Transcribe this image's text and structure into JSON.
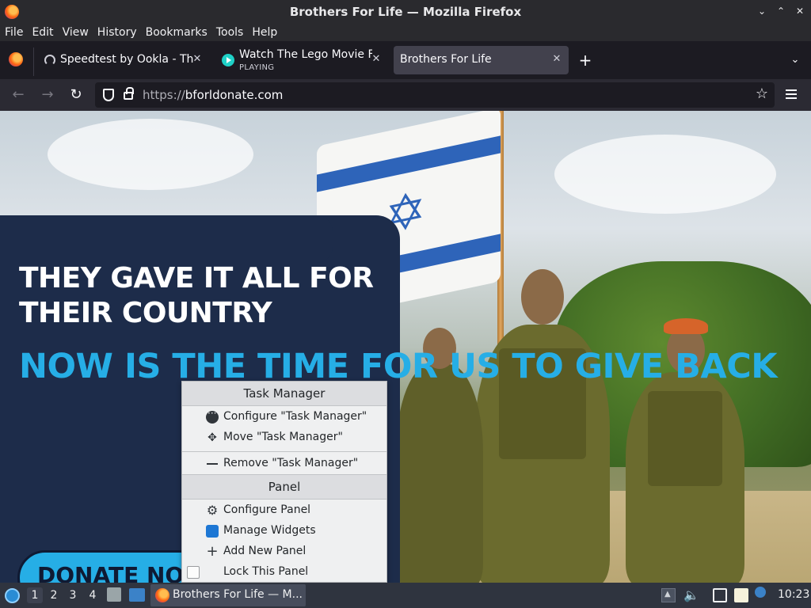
{
  "window": {
    "title": "Brothers For Life — Mozilla Firefox",
    "controls": [
      "⌄",
      "⌃",
      "✕"
    ]
  },
  "menubar": {
    "items": [
      "File",
      "Edit",
      "View",
      "History",
      "Bookmarks",
      "Tools",
      "Help"
    ]
  },
  "tabs": [
    {
      "title": "Speedtest by Ookla - The Global Broadband Speed Test",
      "icon": "speedtest-icon"
    },
    {
      "title": "Watch The Lego Movie Full Movie",
      "subtitle": "PLAYING",
      "icon": "play-icon"
    },
    {
      "title": "Brothers For Life",
      "active": true
    }
  ],
  "navbar": {
    "url_scheme": "https://",
    "url_host": "bforldonate.com"
  },
  "page": {
    "headline_1": "THEY GAVE IT ALL FOR THEIR COUNTRY",
    "headline_2": "NOW IS THE TIME FOR US TO GIVE BACK",
    "donate_label": "DONATE NOW",
    "colors": {
      "navy": "#1d2c4a",
      "accent": "#26aee6"
    }
  },
  "context_menu": {
    "task_manager_header": "Task Manager",
    "configure_task_manager": "Configure \"Task Manager\"",
    "move_task_manager": "Move \"Task Manager\"",
    "remove_task_manager": "Remove \"Task Manager\"",
    "panel_header": "Panel",
    "configure_panel": "Configure Panel",
    "manage_widgets": "Manage Widgets",
    "add_new_panel": "Add New Panel",
    "lock_this_panel": "Lock This Panel"
  },
  "taskbar": {
    "desktops": [
      "1",
      "2",
      "3",
      "4"
    ],
    "active_desktop": "1",
    "task_label": "Brothers For Life — M...",
    "clock": "10:23"
  }
}
